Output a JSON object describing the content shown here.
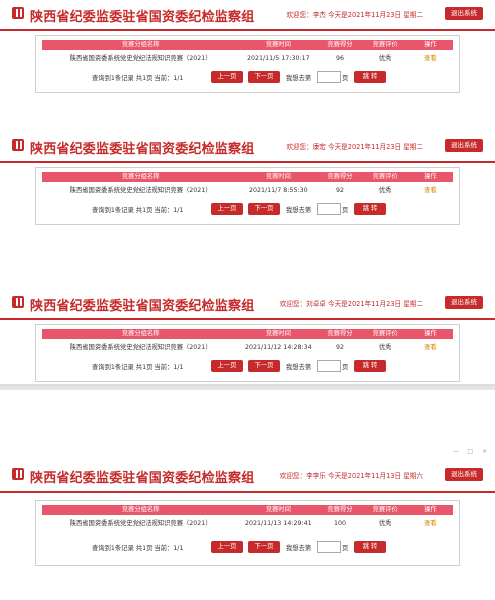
{
  "header": {
    "title": "陕西省纪委监委驻省国资委纪检监察组",
    "logout_label": "退出系统"
  },
  "table_headers": [
    "竞赛分组名称",
    "竞赛时间",
    "竞赛得分",
    "竞赛评价",
    "操作"
  ],
  "pager": {
    "summary": "查询到1条记录  共1页  当前：1/1",
    "prev_label": "上一页",
    "next_label": "下一页",
    "goto_label": "我想去第",
    "page_unit": "页",
    "jump_label": "跳 转"
  },
  "window_controls": [
    "—",
    "□",
    "×"
  ],
  "panels": [
    {
      "welcome": "欢迎您：李杰  今天是2021年11月23日  星期二",
      "row": {
        "name": "陕西省国资委系统党史党纪法规知识竞赛（2021）",
        "time": "2021/11/5 17:30:17",
        "score": "96",
        "rating": "优秀",
        "action": "查看"
      }
    },
    {
      "welcome": "欢迎您：康宏  今天是2021年11月23日  星期二",
      "row": {
        "name": "陕西省国资委系统党史党纪法规知识竞赛（2021）",
        "time": "2021/11/7 8:55:30",
        "score": "92",
        "rating": "优秀",
        "action": "查看"
      }
    },
    {
      "welcome": "欢迎您：刘卓卓  今天是2021年11月23日  星期二",
      "row": {
        "name": "陕西省国资委系统党史党纪法规知识竞赛（2021）",
        "time": "2021/11/12 14:28:34",
        "score": "92",
        "rating": "优秀",
        "action": "查看"
      }
    },
    {
      "welcome": "欢迎您：李李乐  今天是2021年11月13日  星期六",
      "row": {
        "name": "陕西省国资委系统党史党纪法规知识竞赛（2021）",
        "time": "2021/11/13 14:29:41",
        "score": "100",
        "rating": "优秀",
        "action": "查看"
      }
    }
  ]
}
